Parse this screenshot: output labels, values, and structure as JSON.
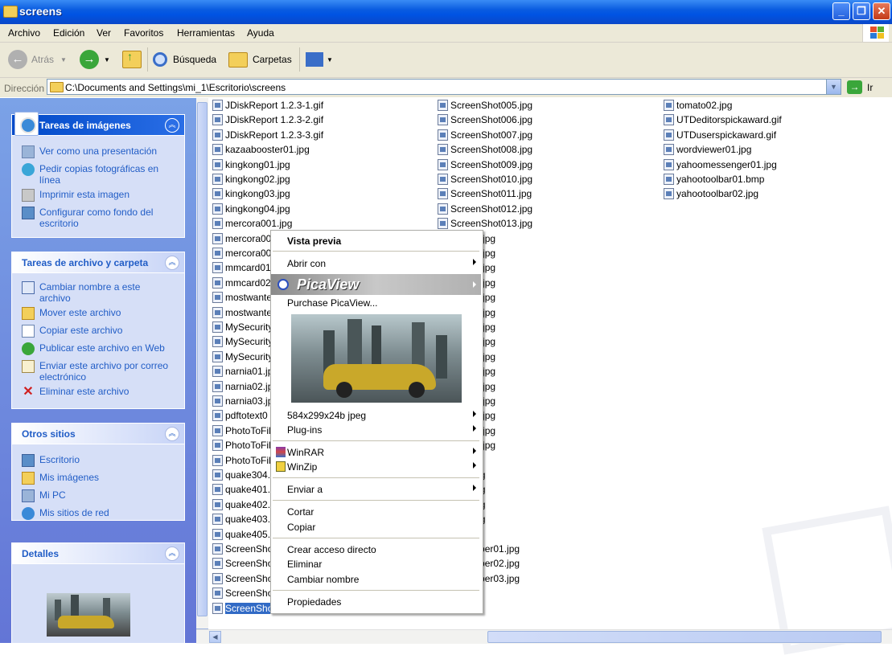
{
  "window": {
    "title": "screens"
  },
  "menu": [
    "Archivo",
    "Edición",
    "Ver",
    "Favoritos",
    "Herramientas",
    "Ayuda"
  ],
  "toolbar": {
    "back": "Atrás",
    "search": "Búsqueda",
    "folders": "Carpetas"
  },
  "address": {
    "label": "Dirección",
    "path": "C:\\Documents and Settings\\mi_1\\Escritorio\\screens",
    "go": "Ir"
  },
  "panels": {
    "image_tasks": {
      "title": "Tareas de imágenes",
      "items": [
        "Ver como una presentación",
        "Pedir copias fotográficas en línea",
        "Imprimir esta imagen",
        "Configurar como fondo del escritorio"
      ]
    },
    "file_tasks": {
      "title": "Tareas de archivo y carpeta",
      "items": [
        "Cambiar nombre a este archivo",
        "Mover este archivo",
        "Copiar este archivo",
        "Publicar este archivo en Web",
        "Enviar este archivo por correo electrónico",
        "Eliminar este archivo"
      ]
    },
    "other_places": {
      "title": "Otros sitios",
      "items": [
        "Escritorio",
        "Mis imágenes",
        "Mi PC",
        "Mis sitios de red"
      ]
    },
    "details": {
      "title": "Detalles"
    }
  },
  "files": {
    "col1": [
      "JDiskReport 1.2.3-1.gif",
      "JDiskReport 1.2.3-2.gif",
      "JDiskReport 1.2.3-3.gif",
      "kazaabooster01.jpg",
      "kingkong01.jpg",
      "kingkong02.jpg",
      "kingkong03.jpg",
      "kingkong04.jpg",
      "mercora001.jpg",
      "mercora00",
      "mercora00",
      "mmcard01.",
      "mmcard02.",
      "mostwante",
      "mostwante",
      "MySecurity",
      "MySecurity",
      "MySecurity",
      "narnia01.jp",
      "narnia02.jp",
      "narnia03.jp",
      "pdftotext0",
      "PhotoToFil",
      "PhotoToFil",
      "PhotoToFil",
      "quake304.",
      "quake401.",
      "quake402.",
      "quake403.",
      "quake405.",
      "ScreenSho",
      "ScreenSho",
      "ScreenSho",
      "ScreenSho",
      "ScreenSho"
    ],
    "col2": [
      "ScreenShot005.jpg",
      "ScreenShot006.jpg",
      "ScreenShot007.jpg",
      "ScreenShot008.jpg",
      "ScreenShot009.jpg",
      "ScreenShot010.jpg",
      "ScreenShot011.jpg",
      "ScreenShot012.jpg",
      "ScreenShot013.jpg",
      "hot014.jpg",
      "hot015.jpg",
      "hot016.jpg",
      "hot017.jpg",
      "hot018.jpg",
      "hot019.jpg",
      "hot020.jpg",
      "hot021.jpg",
      "hot022.jpg",
      "hot023.jpg",
      "hot024.jpg",
      "hot025.jpg",
      "hot026.jpg",
      "hot028.jpg",
      "hot029.jpg",
      "jpg",
      "er01.jpg",
      "er02.jpg",
      "er03.jpg",
      "er04.jpg",
      "1.jpg",
      "mekeeper01.jpg",
      "mekeeper02.jpg",
      "mekeeper03.jpg",
      ".db",
      "01.jpg"
    ],
    "col3": [
      "tomato02.jpg",
      "UTDeditorspickaward.gif",
      "UTDuserspickaward.gif",
      "wordviewer01.jpg",
      "yahoomessenger01.jpg",
      "yahootoolbar01.bmp",
      "yahootoolbar02.jpg"
    ],
    "selected_suffix": ".jpg"
  },
  "context_menu": {
    "preview": "Vista previa",
    "open_with": "Abrir con",
    "picaview": "PicaView",
    "purchase": "Purchase PicaView...",
    "image_info": "584x299x24b jpeg",
    "plugins": "Plug-ins",
    "winrar": "WinRAR",
    "winzip": "WinZip",
    "send_to": "Enviar a",
    "cut": "Cortar",
    "copy": "Copiar",
    "shortcut": "Crear acceso directo",
    "delete": "Eliminar",
    "rename": "Cambiar nombre",
    "properties": "Propiedades"
  }
}
